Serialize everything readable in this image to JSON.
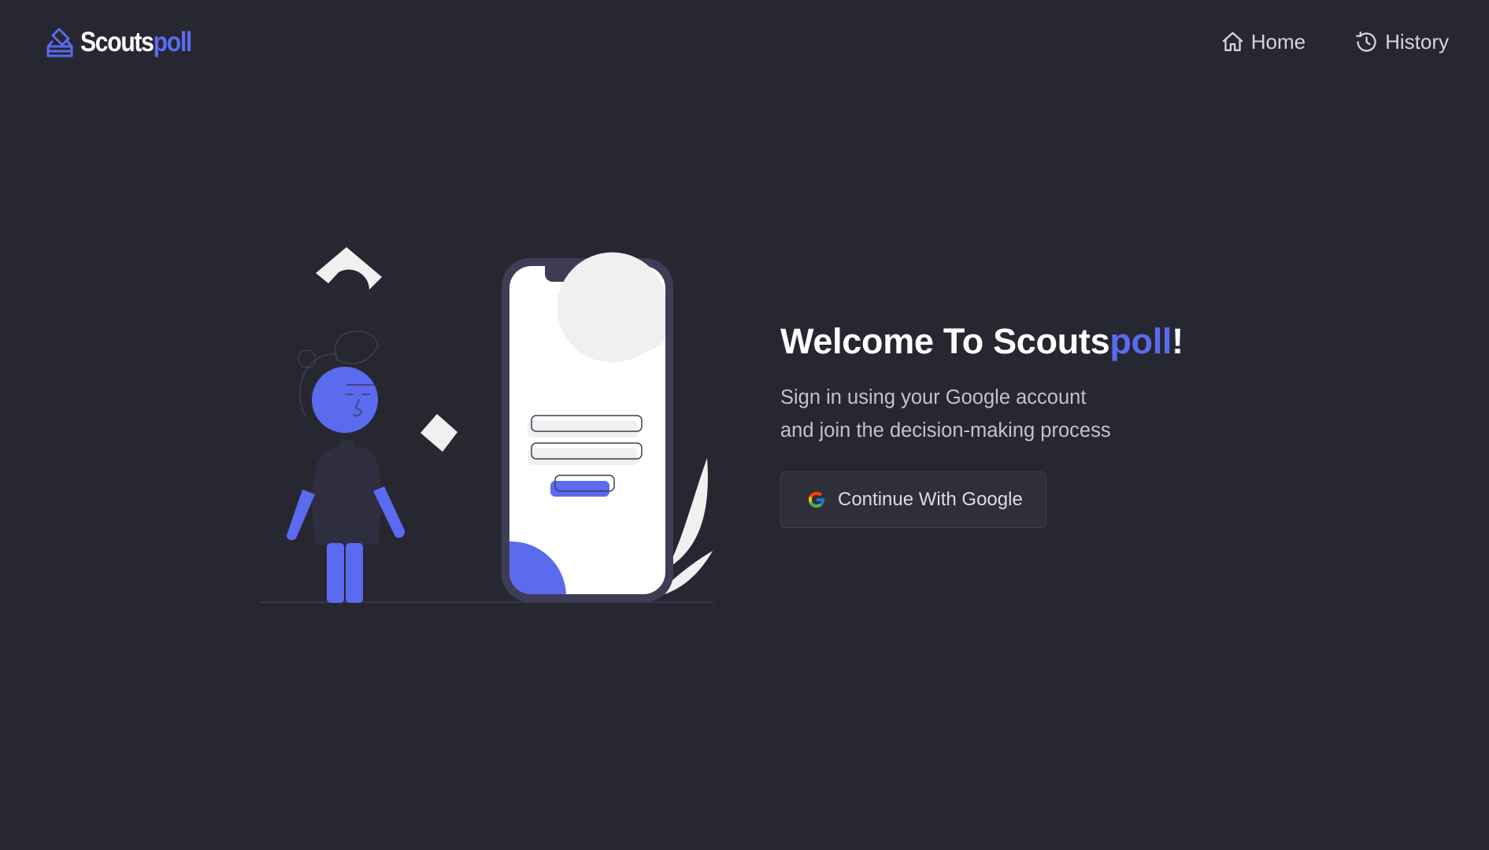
{
  "header": {
    "brand": {
      "part1": "Scouts",
      "part2": "poll",
      "icon": "ballot-box-icon"
    },
    "nav": [
      {
        "label": "Home",
        "icon": "home-icon"
      },
      {
        "label": "History",
        "icon": "history-icon"
      }
    ]
  },
  "hero": {
    "title_prefix": "Welcome To Scouts",
    "title_accent": "poll",
    "title_suffix": "!",
    "subtitle_line1": "Sign in using your Google account",
    "subtitle_line2": "and join the decision-making process",
    "google_button": {
      "label": "Continue With Google",
      "icon": "google-icon"
    }
  },
  "illustration": {
    "name": "person-with-phone-login-illustration"
  },
  "colors": {
    "background": "#272731",
    "accent": "#5a6bf0",
    "text_primary": "#ffffff",
    "text_secondary": "#c2c2cc",
    "button_bg": "#2f2f3a"
  }
}
